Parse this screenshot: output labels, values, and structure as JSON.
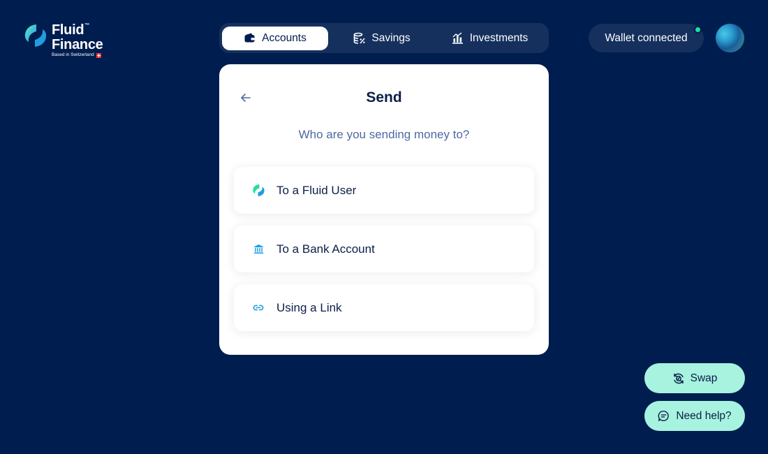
{
  "logo": {
    "line1": "Fluid",
    "trademark": "™",
    "line2": "Finance",
    "tagline": "Based in Switzerland"
  },
  "nav": {
    "tabs": [
      {
        "label": "Accounts",
        "icon": "wallet-icon",
        "active": true
      },
      {
        "label": "Savings",
        "icon": "coins-percent-icon",
        "active": false
      },
      {
        "label": "Investments",
        "icon": "bar-chart-icon",
        "active": false
      }
    ]
  },
  "wallet": {
    "label": "Wallet connected",
    "status_color": "#1ee0a1"
  },
  "send_card": {
    "title": "Send",
    "subtitle": "Who are you sending money to?",
    "options": [
      {
        "label": "To a Fluid User",
        "icon": "fluid-logo-icon"
      },
      {
        "label": "To a Bank Account",
        "icon": "bank-icon"
      },
      {
        "label": "Using a Link",
        "icon": "link-icon"
      }
    ]
  },
  "actions": {
    "swap_label": "Swap",
    "help_label": "Need help?"
  },
  "colors": {
    "background": "#001d4f",
    "surface": "#16305e",
    "accent_mint": "#a7f3df",
    "accent_blue": "#1f9ee0",
    "text_dark": "#0b1f47",
    "text_muted": "#4d6aa3"
  }
}
